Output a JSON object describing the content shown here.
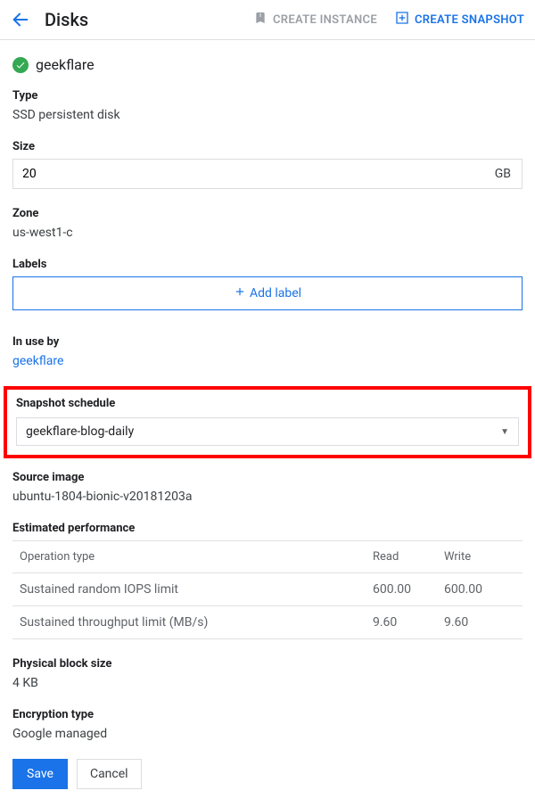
{
  "header": {
    "title": "Disks",
    "create_instance": "CREATE INSTANCE",
    "create_snapshot": "CREATE SNAPSHOT"
  },
  "disk": {
    "name": "geekflare"
  },
  "labels": {
    "type": "Type",
    "size": "Size",
    "zone": "Zone",
    "labels_section": "Labels",
    "add_label": "Add label",
    "in_use_by": "In use by",
    "snapshot_schedule": "Snapshot schedule",
    "source_image": "Source image",
    "est_perf": "Estimated performance",
    "physical_block": "Physical block size",
    "encryption": "Encryption type"
  },
  "values": {
    "type": "SSD persistent disk",
    "size": "20",
    "size_unit": "GB",
    "zone": "us-west1-c",
    "in_use_by": "geekflare",
    "snapshot_schedule": "geekflare-blog-daily",
    "source_image": "ubuntu-1804-bionic-v20181203a",
    "physical_block": "4 KB",
    "encryption": "Google managed"
  },
  "perf": {
    "col_op": "Operation type",
    "col_read": "Read",
    "col_write": "Write",
    "rows": [
      {
        "op": "Sustained random IOPS limit",
        "read": "600.00",
        "write": "600.00"
      },
      {
        "op": "Sustained throughput limit (MB/s)",
        "read": "9.60",
        "write": "9.60"
      }
    ]
  },
  "buttons": {
    "save": "Save",
    "cancel": "Cancel"
  }
}
